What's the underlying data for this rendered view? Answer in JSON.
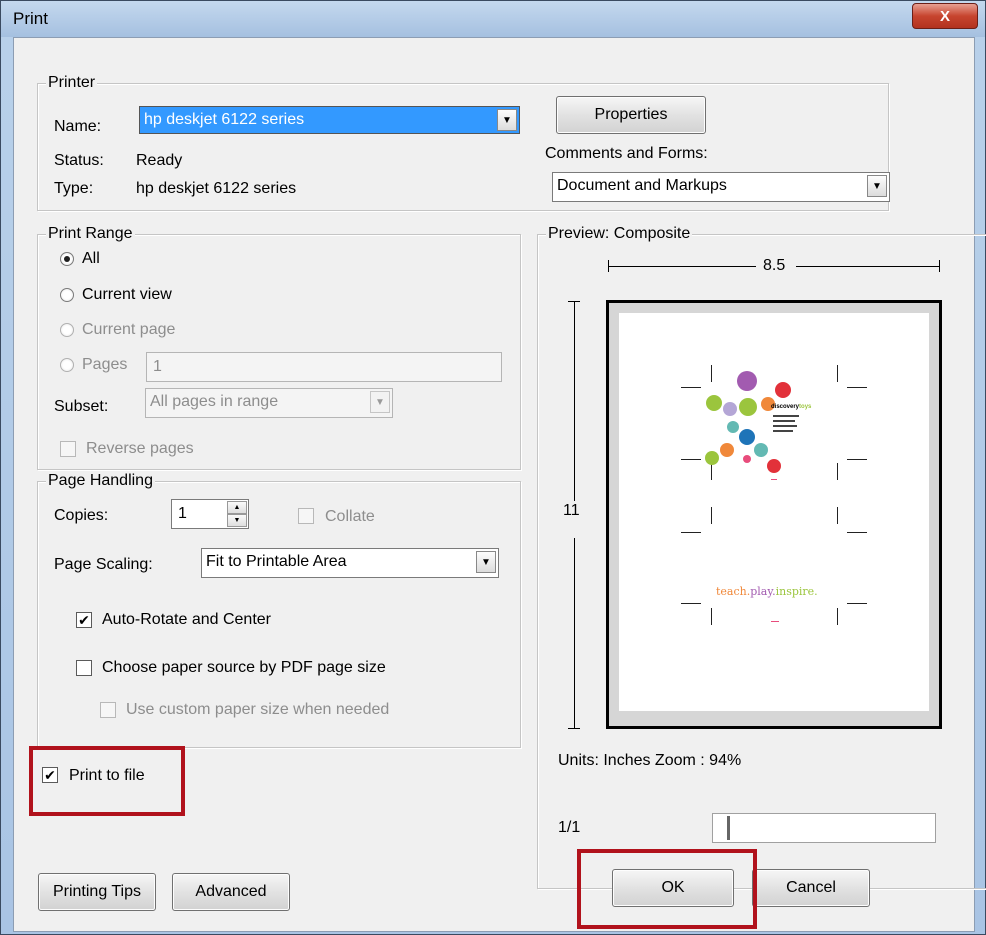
{
  "window": {
    "title": "Print",
    "close_glyph": "X"
  },
  "printer": {
    "legend": "Printer",
    "name_label": "Name:",
    "name_value": "hp deskjet 6122 series",
    "status_label": "Status:",
    "status_value": "Ready",
    "type_label": "Type:",
    "type_value": "hp deskjet 6122 series",
    "properties_label": "Properties",
    "comments_label": "Comments and Forms:",
    "comments_value": "Document and Markups"
  },
  "print_range": {
    "legend": "Print Range",
    "all_label": "All",
    "current_view_label": "Current view",
    "current_page_label": "Current page",
    "pages_label": "Pages",
    "pages_value": "1",
    "subset_label": "Subset:",
    "subset_value": "All pages in range",
    "reverse_label": "Reverse pages",
    "selected": "All"
  },
  "page_handling": {
    "legend": "Page Handling",
    "copies_label": "Copies:",
    "copies_value": "1",
    "collate_label": "Collate",
    "scaling_label": "Page Scaling:",
    "scaling_value": "Fit to Printable Area",
    "auto_rotate_label": "Auto-Rotate and Center",
    "auto_rotate_checked": true,
    "paper_source_label": "Choose paper source by PDF page size",
    "paper_source_checked": false,
    "custom_paper_label": "Use custom paper size when needed",
    "custom_paper_checked": false
  },
  "print_to_file": {
    "label": "Print to file",
    "checked": true
  },
  "preview": {
    "legend": "Preview: Composite",
    "width_label": "8.5",
    "height_label": "11",
    "logo_word_primary": "discovery",
    "logo_word_accent": "toys",
    "tagline_1": "teach.",
    "tagline_2": "play.",
    "tagline_3": "inspire.",
    "units_zoom": "Units: Inches Zoom :  94%",
    "page_indicator": "1/1",
    "colors": {
      "orange": "#f0883a",
      "purple": "#a25bb0",
      "red": "#e2313a",
      "green": "#9bc53d",
      "blue": "#1e74b8",
      "teal": "#63b9b3",
      "lavender": "#b4a6d6",
      "pink": "#e84c7c"
    }
  },
  "buttons": {
    "printing_tips": "Printing Tips",
    "advanced": "Advanced",
    "ok": "OK",
    "cancel": "Cancel"
  },
  "glyphs": {
    "dropdown": "▼",
    "check": "✔",
    "spin_up": "▲",
    "spin_down": "▼"
  }
}
